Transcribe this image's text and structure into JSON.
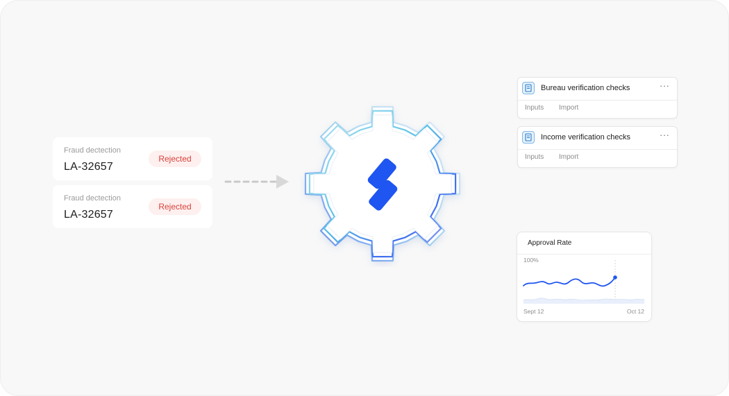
{
  "fraud_cards": [
    {
      "label": "Fraud dectection",
      "id": "LA-32657",
      "status": "Rejected"
    },
    {
      "label": "Fraud dectection",
      "id": "LA-32657",
      "status": "Rejected"
    }
  ],
  "checks": [
    {
      "title": "Bureau verification checks",
      "more": "···",
      "tabs": [
        "Inputs",
        "Import"
      ]
    },
    {
      "title": "Income verification checks",
      "more": "···",
      "tabs": [
        "Inputs",
        "Import"
      ]
    }
  ],
  "approval": {
    "title": "Approval Rate",
    "y_label": "100%",
    "x_start": "Sept 12",
    "x_end": "Oct 12"
  },
  "colors": {
    "brand_blue": "#1f55f0",
    "rejected_text": "#d8423a",
    "rejected_bg": "#fdf0ef"
  },
  "icons": [
    "dashed-arrow-icon",
    "gear-icon",
    "brand-logo-icon",
    "document-icon",
    "more-icon"
  ]
}
